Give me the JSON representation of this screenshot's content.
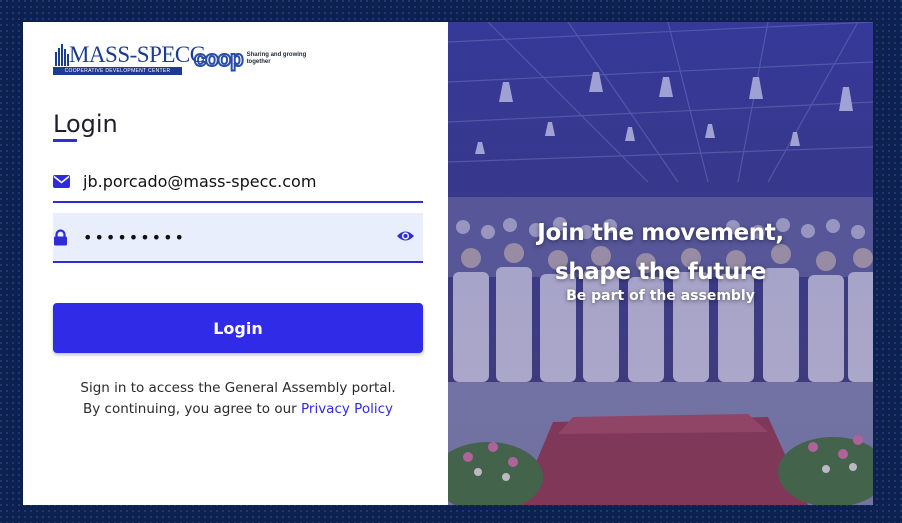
{
  "branding": {
    "mass_specc_name": "MASS-SPECC",
    "mass_specc_subtitle": "COOPERATIVE DEVELOPMENT CENTER",
    "coop_word": "coop",
    "coop_tagline": "Sharing and growing together",
    "accent_color": "#2f2be6",
    "brand_blue": "#1b3c8f"
  },
  "form": {
    "title": "Login",
    "email_value": "jb.porcado@mass-specc.com",
    "email_icon": "envelope-icon",
    "password_value": "•••••••••",
    "password_icon": "lock-icon",
    "visibility_icon": "eye-icon",
    "submit_label": "Login"
  },
  "info": {
    "line1": "Sign in to access the General Assembly portal.",
    "line2_prefix": "By continuing, you agree to our ",
    "privacy_link": "Privacy Policy"
  },
  "hero": {
    "line1": "Join the movement,",
    "line2": "shape the future",
    "subtitle": "Be part of the assembly"
  }
}
